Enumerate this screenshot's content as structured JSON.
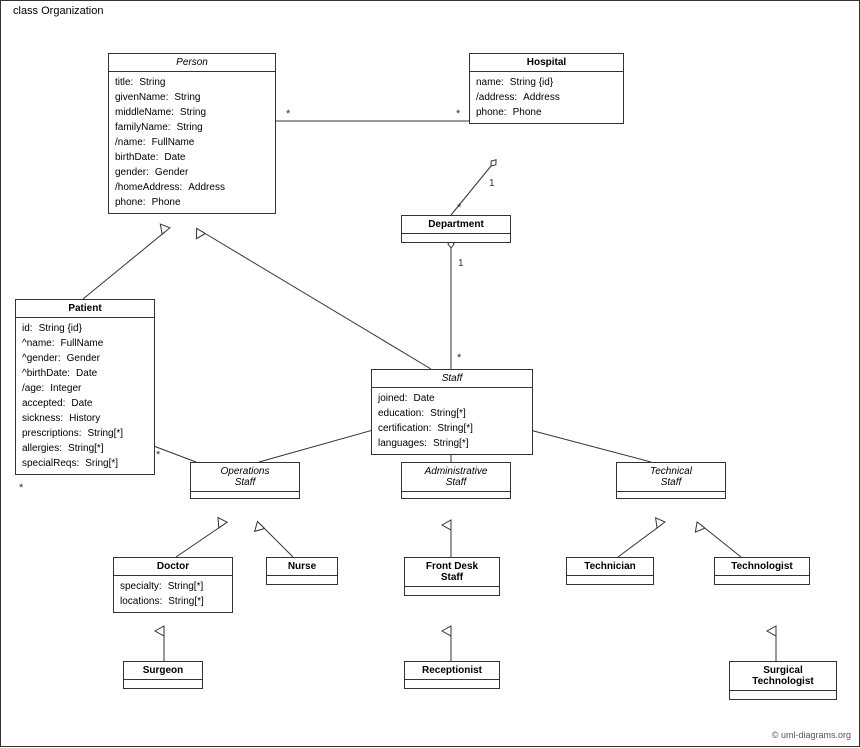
{
  "diagram": {
    "title": "class Organization",
    "classes": {
      "person": {
        "name": "Person",
        "italic": true,
        "attrs": [
          {
            "name": "title:",
            "type": "String"
          },
          {
            "name": "givenName:",
            "type": "String"
          },
          {
            "name": "middleName:",
            "type": "String"
          },
          {
            "name": "familyName:",
            "type": "String"
          },
          {
            "name": "/name:",
            "type": "FullName"
          },
          {
            "name": "birthDate:",
            "type": "Date"
          },
          {
            "name": "gender:",
            "type": "Gender"
          },
          {
            "name": "/homeAddress:",
            "type": "Address"
          },
          {
            "name": "phone:",
            "type": "Phone"
          }
        ]
      },
      "hospital": {
        "name": "Hospital",
        "italic": false,
        "attrs": [
          {
            "name": "name:",
            "type": "String {id}"
          },
          {
            "name": "/address:",
            "type": "Address"
          },
          {
            "name": "phone:",
            "type": "Phone"
          }
        ]
      },
      "patient": {
        "name": "Patient",
        "italic": false,
        "attrs": [
          {
            "name": "id:",
            "type": "String {id}"
          },
          {
            "name": "^name:",
            "type": "FullName"
          },
          {
            "name": "^gender:",
            "type": "Gender"
          },
          {
            "name": "^birthDate:",
            "type": "Date"
          },
          {
            "name": "/age:",
            "type": "Integer"
          },
          {
            "name": "accepted:",
            "type": "Date"
          },
          {
            "name": "sickness:",
            "type": "History"
          },
          {
            "name": "prescriptions:",
            "type": "String[*]"
          },
          {
            "name": "allergies:",
            "type": "String[*]"
          },
          {
            "name": "specialReqs:",
            "type": "Sring[*]"
          }
        ]
      },
      "department": {
        "name": "Department",
        "italic": false,
        "attrs": []
      },
      "staff": {
        "name": "Staff",
        "italic": true,
        "attrs": [
          {
            "name": "joined:",
            "type": "Date"
          },
          {
            "name": "education:",
            "type": "String[*]"
          },
          {
            "name": "certification:",
            "type": "String[*]"
          },
          {
            "name": "languages:",
            "type": "String[*]"
          }
        ]
      },
      "operations_staff": {
        "name": "Operations Staff",
        "italic": true,
        "attrs": []
      },
      "administrative_staff": {
        "name": "Administrative Staff",
        "italic": true,
        "attrs": []
      },
      "technical_staff": {
        "name": "Technical Staff",
        "italic": true,
        "attrs": []
      },
      "doctor": {
        "name": "Doctor",
        "italic": false,
        "attrs": [
          {
            "name": "specialty:",
            "type": "String[*]"
          },
          {
            "name": "locations:",
            "type": "String[*]"
          }
        ]
      },
      "nurse": {
        "name": "Nurse",
        "italic": false,
        "attrs": []
      },
      "front_desk_staff": {
        "name": "Front Desk Staff",
        "italic": false,
        "attrs": []
      },
      "technician": {
        "name": "Technician",
        "italic": false,
        "attrs": []
      },
      "technologist": {
        "name": "Technologist",
        "italic": false,
        "attrs": []
      },
      "surgeon": {
        "name": "Surgeon",
        "italic": false,
        "attrs": []
      },
      "receptionist": {
        "name": "Receptionist",
        "italic": false,
        "attrs": []
      },
      "surgical_technologist": {
        "name": "Surgical Technologist",
        "italic": false,
        "attrs": []
      }
    },
    "copyright": "© uml-diagrams.org"
  }
}
